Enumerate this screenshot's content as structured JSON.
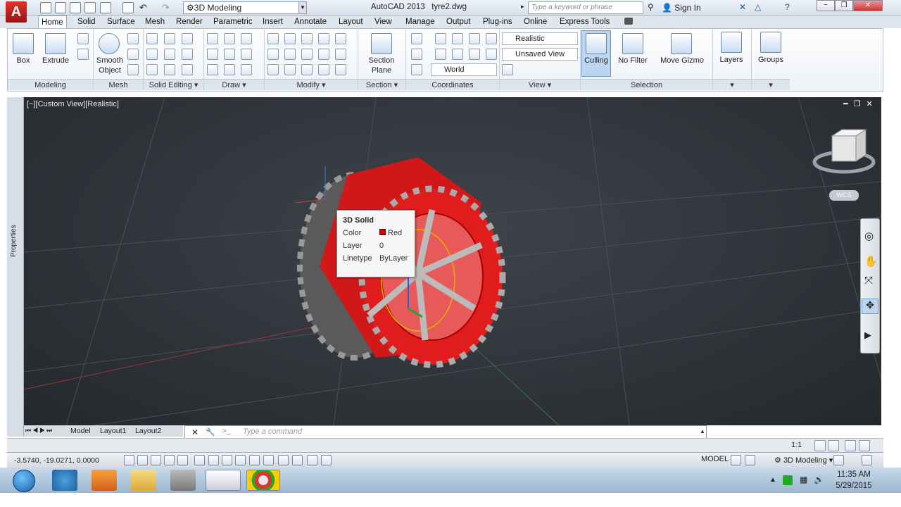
{
  "titlebar": {
    "app_title": "AutoCAD 2013",
    "file": "tyre2.dwg",
    "workspace": "3D Modeling",
    "search_placeholder": "Type a keyword or phrase",
    "sign_in": "Sign In"
  },
  "tabs": [
    "Home",
    "Solid",
    "Surface",
    "Mesh",
    "Render",
    "Parametric",
    "Insert",
    "Annotate",
    "Layout",
    "View",
    "Manage",
    "Output",
    "Plug-ins",
    "Online",
    "Express Tools"
  ],
  "ribbon": {
    "modeling": {
      "title": "Modeling",
      "box": "Box",
      "extrude": "Extrude"
    },
    "mesh": {
      "title": "Mesh",
      "smooth_object_line1": "Smooth",
      "smooth_object_line2": "Object"
    },
    "solid_editing": {
      "title": "Solid Editing"
    },
    "draw": {
      "title": "Draw"
    },
    "modify": {
      "title": "Modify"
    },
    "section": {
      "title": "Section",
      "plane_line1": "Section",
      "plane_line2": "Plane"
    },
    "coordinates": {
      "title": "Coordinates",
      "ucs": "World"
    },
    "view": {
      "title": "View",
      "visual_style": "Realistic",
      "named_view": "Unsaved View"
    },
    "selection": {
      "title": "Selection",
      "culling": "Culling",
      "filter": "No Filter",
      "gizmo": "Move Gizmo"
    },
    "layers": "Layers",
    "groups": "Groups"
  },
  "viewport": {
    "label": "[−][Custom View][Realistic]",
    "wcs": "WCS"
  },
  "tooltip": {
    "title": "3D Solid",
    "color_key": "Color",
    "color_val": "Red",
    "layer_key": "Layer",
    "layer_val": "0",
    "linetype_key": "Linetype",
    "linetype_val": "ByLayer",
    "swatch": "#cc0000"
  },
  "side": {
    "properties": "Properties"
  },
  "layout_tabs": [
    "Model",
    "Layout1",
    "Layout2"
  ],
  "command": {
    "placeholder": "Type a command"
  },
  "status": {
    "coords": "-3.5740, -19.0271, 0.0000",
    "model": "MODEL",
    "workspace": "3D Modeling",
    "annoscale": "1:1"
  },
  "taskbar": {
    "time": "11:35 AM",
    "date": "5/29/2015"
  }
}
